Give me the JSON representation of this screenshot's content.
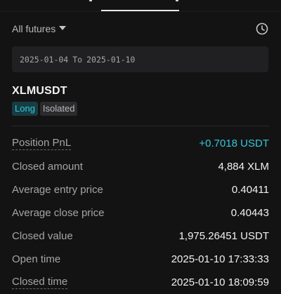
{
  "filter": {
    "label": "All futures"
  },
  "date_range": {
    "start": "2025-01-04",
    "separator": "To",
    "end": "2025-01-10"
  },
  "position": {
    "symbol": "XLMUSDT",
    "side": "Long",
    "margin_mode": "Isolated"
  },
  "details": [
    {
      "label": "Position PnL",
      "value": "+0.7018 USDT"
    },
    {
      "label": "Closed amount",
      "value": "4,884 XLM"
    },
    {
      "label": "Average entry price",
      "value": "0.40411"
    },
    {
      "label": "Average close price",
      "value": "0.40443"
    },
    {
      "label": "Closed value",
      "value": "1,975.26451 USDT"
    },
    {
      "label": "Open time",
      "value": "2025-01-10 17:33:33"
    },
    {
      "label": "Closed time",
      "value": "2025-01-10 18:09:59"
    }
  ],
  "colors": {
    "accent": "#35c7d9",
    "background": "#131314"
  }
}
